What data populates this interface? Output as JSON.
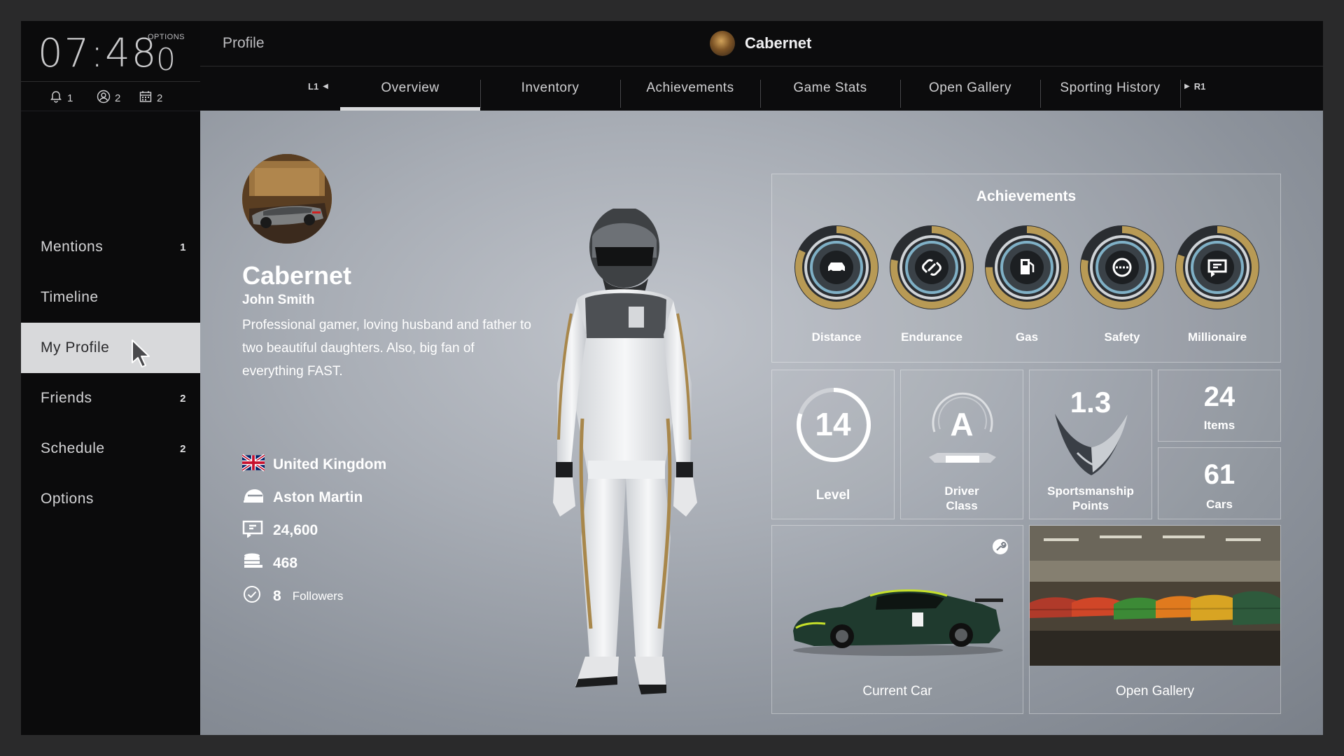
{
  "sidebar": {
    "clock": "07:48",
    "options_label": "OPTIONS",
    "options_value": "0",
    "notifications": [
      {
        "icon": "bell-icon",
        "count": "1"
      },
      {
        "icon": "person-circle-icon",
        "count": "2"
      },
      {
        "icon": "calendar-icon",
        "count": "2"
      }
    ],
    "items": [
      {
        "label": "Mentions",
        "count": "1"
      },
      {
        "label": "Timeline",
        "count": ""
      },
      {
        "label": "My Profile",
        "count": ""
      },
      {
        "label": "Friends",
        "count": "2"
      },
      {
        "label": "Schedule",
        "count": "2"
      },
      {
        "label": "Options",
        "count": ""
      }
    ]
  },
  "header": {
    "title": "Profile",
    "user_name": "Cabernet"
  },
  "tabs": {
    "left_bumper": "L1",
    "right_bumper": "R1",
    "items": [
      {
        "label": "Overview"
      },
      {
        "label": "Inventory"
      },
      {
        "label": "Achievements"
      },
      {
        "label": "Game Stats"
      },
      {
        "label": "Open Gallery"
      },
      {
        "label": "Sporting History"
      }
    ],
    "active": "Overview"
  },
  "profile": {
    "name": "Cabernet",
    "real_name": "John Smith",
    "bio": "Professional gamer, loving husband and father to two beautiful daughters. Also, big fan of everything FAST.",
    "country": "United Kingdom",
    "manufacturer": "Aston Martin",
    "credits": "24,600",
    "coins": "468",
    "followers_count": "8",
    "followers_label": "Followers"
  },
  "achievements": {
    "title": "Achievements",
    "items": [
      {
        "label": "Distance",
        "icon": "car-icon",
        "progress": 0.82
      },
      {
        "label": "Endurance",
        "icon": "link-icon",
        "progress": 0.78
      },
      {
        "label": "Gas",
        "icon": "fuel-pump-icon",
        "progress": 0.75
      },
      {
        "label": "Safety",
        "icon": "safety-icon",
        "progress": 0.78
      },
      {
        "label": "Millionaire",
        "icon": "money-icon",
        "progress": 0.8
      }
    ]
  },
  "stats": {
    "level_value": "14",
    "level_label": "Level",
    "level_progress": 0.8,
    "driver_class_value": "A",
    "driver_class_label_1": "Driver",
    "driver_class_label_2": "Class",
    "sportsmanship_value": "1.3",
    "sportsmanship_label_1": "Sportsmanship",
    "sportsmanship_label_2": "Points",
    "items_value": "24",
    "items_label": "Items",
    "cars_value": "61",
    "cars_label": "Cars"
  },
  "cards": {
    "current_car": "Current Car",
    "open_gallery": "Open Gallery"
  },
  "colors": {
    "accent_gold": "#b89a55",
    "ring_blue": "#7fb0c6",
    "active_tab": "#d8d9db"
  }
}
